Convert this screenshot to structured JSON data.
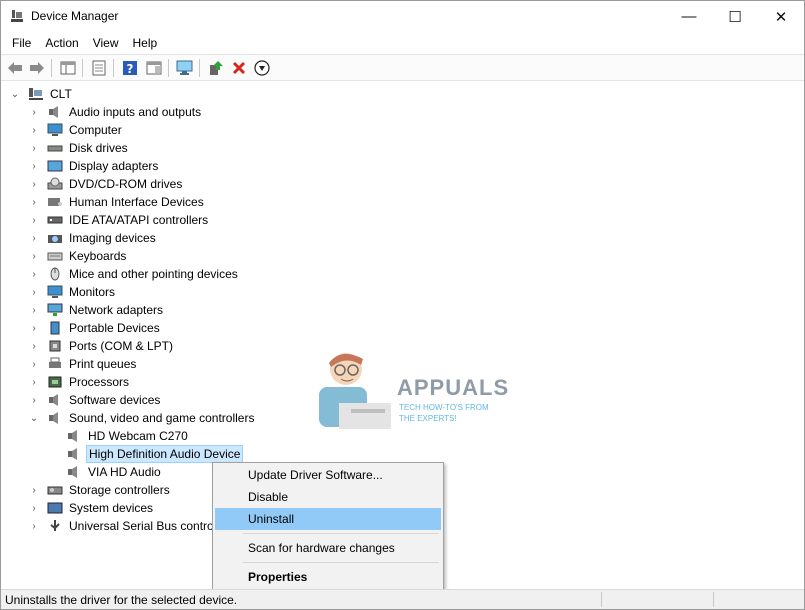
{
  "window": {
    "title": "Device Manager",
    "min_glyph": "—",
    "max_glyph": "☐",
    "close_glyph": "✕"
  },
  "menu": [
    "File",
    "Action",
    "View",
    "Help"
  ],
  "toolbar": {
    "icons": [
      "back-arrow-icon",
      "forward-arrow-icon",
      "show-hide-console-tree-icon",
      "properties-sheet-icon",
      "help-icon",
      "action-pane-icon",
      "scan-hardware-icon",
      "update-driver-icon",
      "uninstall-x-icon",
      "disable-down-arrow-icon"
    ]
  },
  "tree": {
    "root": "CLT",
    "categories": [
      {
        "label": "Audio inputs and outputs",
        "icon": "speaker-icon"
      },
      {
        "label": "Computer",
        "icon": "computer-icon"
      },
      {
        "label": "Disk drives",
        "icon": "disk-drive-icon"
      },
      {
        "label": "Display adapters",
        "icon": "display-adapter-icon"
      },
      {
        "label": "DVD/CD-ROM drives",
        "icon": "dvd-drive-icon"
      },
      {
        "label": "Human Interface Devices",
        "icon": "hid-icon"
      },
      {
        "label": "IDE ATA/ATAPI controllers",
        "icon": "ide-controller-icon"
      },
      {
        "label": "Imaging devices",
        "icon": "camera-icon"
      },
      {
        "label": "Keyboards",
        "icon": "keyboard-icon"
      },
      {
        "label": "Mice and other pointing devices",
        "icon": "mouse-icon"
      },
      {
        "label": "Monitors",
        "icon": "monitor-icon"
      },
      {
        "label": "Network adapters",
        "icon": "network-adapter-icon"
      },
      {
        "label": "Portable Devices",
        "icon": "portable-device-icon"
      },
      {
        "label": "Ports (COM & LPT)",
        "icon": "port-icon"
      },
      {
        "label": "Print queues",
        "icon": "printer-icon"
      },
      {
        "label": "Processors",
        "icon": "processor-icon"
      },
      {
        "label": "Software devices",
        "icon": "speaker-icon"
      },
      {
        "label": "Sound, video and game controllers",
        "icon": "speaker-icon"
      }
    ],
    "sound_children": [
      {
        "label": "HD Webcam C270",
        "icon": "speaker-icon"
      },
      {
        "label": "High Definition Audio Device",
        "icon": "speaker-icon",
        "selected": true
      },
      {
        "label": "VIA HD Audio",
        "icon": "speaker-icon"
      }
    ],
    "after": [
      {
        "label": "Storage controllers",
        "icon": "storage-controller-icon"
      },
      {
        "label": "System devices",
        "icon": "system-device-icon"
      },
      {
        "label": "Universal Serial Bus controll",
        "icon": "usb-icon"
      }
    ]
  },
  "context_menu": {
    "update": "Update Driver Software...",
    "disable": "Disable",
    "uninstall": "Uninstall",
    "scan": "Scan for hardware changes",
    "properties": "Properties"
  },
  "watermark": {
    "brand": "APPUALS",
    "tagline1": "TECH HOW-TO'S FROM",
    "tagline2": "THE EXPERTS!"
  },
  "status": {
    "text": "Uninstalls the driver for the selected device."
  },
  "colors": {
    "selection": "#cce8ff",
    "menu_highlight": "#91c9f7",
    "uninstall_red": "#d9261c"
  }
}
